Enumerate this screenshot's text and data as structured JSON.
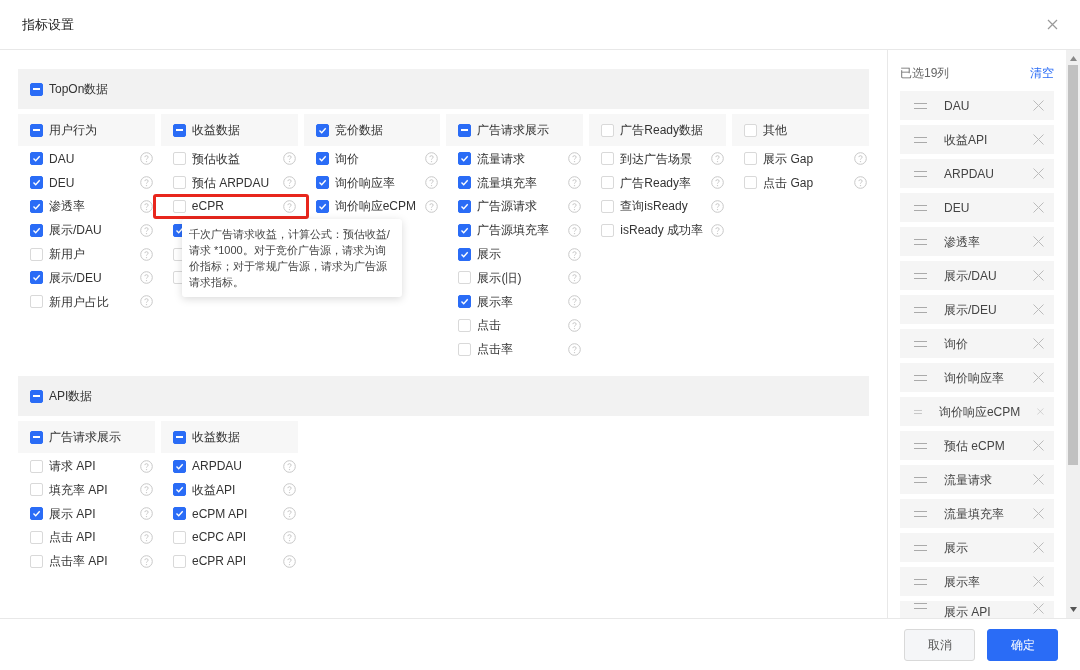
{
  "dialog": {
    "title": "指标设置"
  },
  "sections": [
    {
      "label": "TopOn数据",
      "indeterminate": true,
      "groups": [
        {
          "label": "用户行为",
          "indeterminate": true,
          "items": [
            {
              "label": "DAU",
              "checked": true
            },
            {
              "label": "DEU",
              "checked": true
            },
            {
              "label": "渗透率",
              "checked": true
            },
            {
              "label": "展示/DAU",
              "checked": true
            },
            {
              "label": "新用户",
              "checked": false
            },
            {
              "label": "展示/DEU",
              "checked": true
            },
            {
              "label": "新用户占比",
              "checked": false
            }
          ]
        },
        {
          "label": "收益数据",
          "indeterminate": true,
          "items": [
            {
              "label": "预估收益",
              "checked": false
            },
            {
              "label": "预估 ARPDAU",
              "checked": false
            },
            {
              "label": "eCPR",
              "checked": false,
              "highlighted": true,
              "tooltip": "千次广告请求收益，计算公式：预估收益/请求 *1000。对于竞价广告源，请求为询价指标；对于常规广告源，请求为广告源请求指标。"
            },
            {
              "checked": true
            },
            {
              "checked": false
            },
            {
              "checked": false
            }
          ]
        },
        {
          "label": "竞价数据",
          "checked": true,
          "items": [
            {
              "label": "询价",
              "checked": true
            },
            {
              "label": "询价响应率",
              "checked": true
            },
            {
              "label": "询价响应eCPM",
              "checked": true
            }
          ]
        },
        {
          "label": "广告请求展示",
          "indeterminate": true,
          "items": [
            {
              "label": "流量请求",
              "checked": true
            },
            {
              "label": "流量填充率",
              "checked": true
            },
            {
              "label": "广告源请求",
              "checked": true
            },
            {
              "label": "广告源填充率",
              "checked": true
            },
            {
              "label": "展示",
              "checked": true
            },
            {
              "label": "展示(旧)",
              "checked": false
            },
            {
              "label": "展示率",
              "checked": true
            },
            {
              "label": "点击",
              "checked": false
            },
            {
              "label": "点击率",
              "checked": false
            }
          ]
        },
        {
          "label": "广告Ready数据",
          "checked": false,
          "indeterminate": false,
          "items": [
            {
              "label": "到达广告场景",
              "checked": false
            },
            {
              "label": "广告Ready率",
              "checked": false
            },
            {
              "label": "查询isReady",
              "checked": false
            },
            {
              "label": "isReady 成功率",
              "checked": false
            }
          ]
        },
        {
          "label": "其他",
          "checked": false,
          "indeterminate": false,
          "items": [
            {
              "label": "展示 Gap",
              "checked": false
            },
            {
              "label": "点击 Gap",
              "checked": false
            }
          ]
        }
      ]
    },
    {
      "label": "API数据",
      "indeterminate": true,
      "groups": [
        {
          "label": "广告请求展示",
          "indeterminate": true,
          "items": [
            {
              "label": "请求 API",
              "checked": false
            },
            {
              "label": "填充率 API",
              "checked": false
            },
            {
              "label": "展示 API",
              "checked": true
            },
            {
              "label": "点击 API",
              "checked": false
            },
            {
              "label": "点击率 API",
              "checked": false
            }
          ]
        },
        {
          "label": "收益数据",
          "indeterminate": true,
          "items": [
            {
              "label": "ARPDAU",
              "checked": true
            },
            {
              "label": "收益API",
              "checked": true
            },
            {
              "label": "eCPM API",
              "checked": true
            },
            {
              "label": "eCPC API",
              "checked": false
            },
            {
              "label": "eCPR API",
              "checked": false
            }
          ]
        }
      ]
    }
  ],
  "selected_panel": {
    "title": "已选19列",
    "clear_link": "清空",
    "items": [
      "DAU",
      "收益API",
      "ARPDAU",
      "DEU",
      "渗透率",
      "展示/DAU",
      "展示/DEU",
      "询价",
      "询价响应率",
      "询价响应eCPM",
      "预估 eCPM",
      "流量请求",
      "流量填充率",
      "展示",
      "展示率",
      "展示 API"
    ]
  },
  "buttons": [
    {
      "label": "取消",
      "kind": "secondary"
    },
    {
      "label": "确定",
      "kind": "primary"
    }
  ]
}
